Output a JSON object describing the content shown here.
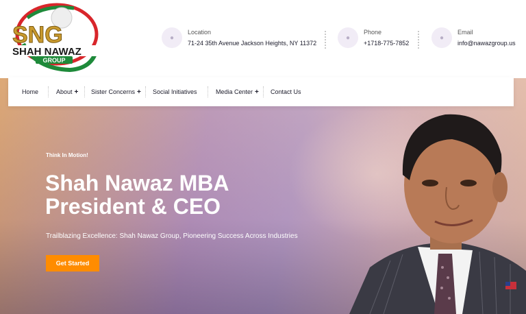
{
  "header": {
    "logo": {
      "letters": "SNG",
      "text": "SHAH NAWAZ",
      "subtext": "GROUP"
    },
    "contacts": [
      {
        "label": "Location",
        "value": "71-24 35th Avenue Jackson Heights, NY 11372",
        "icon": "map-pin-icon"
      },
      {
        "label": "Phone",
        "value": "+1718-775-7852",
        "icon": "phone-icon"
      },
      {
        "label": "Email",
        "value": "info@nawazgroup.us",
        "icon": "envelope-icon"
      }
    ]
  },
  "nav": {
    "items": [
      {
        "label": "Home",
        "has_submenu": false
      },
      {
        "label": "About",
        "has_submenu": true
      },
      {
        "label": "Sister Concerns",
        "has_submenu": true
      },
      {
        "label": "Social Initiatives",
        "has_submenu": false
      },
      {
        "label": "Media Center",
        "has_submenu": true
      },
      {
        "label": "Contact Us",
        "has_submenu": false
      }
    ],
    "submenu_marker": "+"
  },
  "hero": {
    "tagline": "Think In Motion!",
    "headline": "Shah Nawaz MBA President & CEO",
    "subline": "Trailblazing Excellence: Shah Nawaz Group, Pioneering Success Across Industries",
    "cta_label": "Get Started"
  },
  "colors": {
    "accent": "#ff8c00",
    "logo_green": "#1e8a3a",
    "logo_red": "#d8262b",
    "logo_gold": "#c99a2e"
  }
}
